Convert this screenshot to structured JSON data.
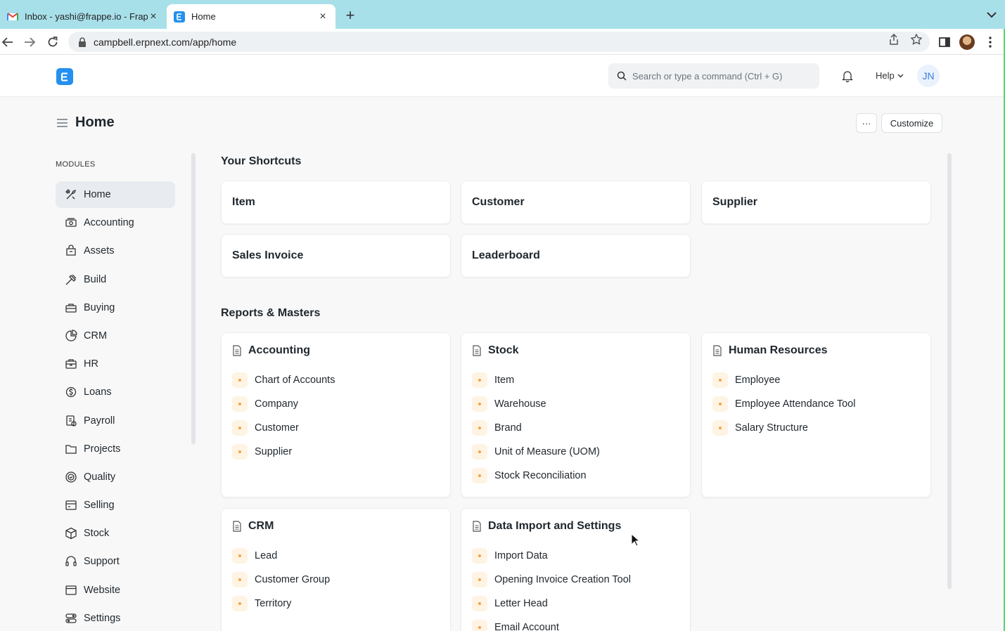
{
  "browser": {
    "tabs": [
      {
        "title": "Inbox - yashi@frappe.io - Frappe",
        "active": false
      },
      {
        "title": "Home",
        "active": true
      }
    ],
    "url": "campbell.erpnext.com/app/home"
  },
  "navbar": {
    "search_placeholder": "Search or type a command (Ctrl + G)",
    "help_label": "Help",
    "avatar_initials": "JN"
  },
  "page": {
    "title": "Home",
    "more_label": "···",
    "customize_label": "Customize"
  },
  "sidebar": {
    "heading": "MODULES",
    "items": [
      {
        "label": "Home",
        "icon": "tools-icon",
        "active": true
      },
      {
        "label": "Accounting",
        "icon": "accounting-icon"
      },
      {
        "label": "Assets",
        "icon": "assets-icon"
      },
      {
        "label": "Build",
        "icon": "build-icon"
      },
      {
        "label": "Buying",
        "icon": "buying-icon"
      },
      {
        "label": "CRM",
        "icon": "crm-icon"
      },
      {
        "label": "HR",
        "icon": "hr-icon"
      },
      {
        "label": "Loans",
        "icon": "loans-icon"
      },
      {
        "label": "Payroll",
        "icon": "payroll-icon"
      },
      {
        "label": "Projects",
        "icon": "projects-icon"
      },
      {
        "label": "Quality",
        "icon": "quality-icon"
      },
      {
        "label": "Selling",
        "icon": "selling-icon"
      },
      {
        "label": "Stock",
        "icon": "stock-icon"
      },
      {
        "label": "Support",
        "icon": "support-icon"
      },
      {
        "label": "Website",
        "icon": "website-icon"
      },
      {
        "label": "Settings",
        "icon": "settings-icon"
      }
    ]
  },
  "shortcuts": {
    "heading": "Your Shortcuts",
    "items": [
      "Item",
      "Customer",
      "Supplier",
      "Sales Invoice",
      "Leaderboard"
    ]
  },
  "reports": {
    "heading": "Reports & Masters",
    "cards": [
      {
        "title": "Accounting",
        "links": [
          "Chart of Accounts",
          "Company",
          "Customer",
          "Supplier"
        ]
      },
      {
        "title": "Stock",
        "links": [
          "Item",
          "Warehouse",
          "Brand",
          "Unit of Measure (UOM)",
          "Stock Reconciliation"
        ]
      },
      {
        "title": "Human Resources",
        "links": [
          "Employee",
          "Employee Attendance Tool",
          "Salary Structure"
        ]
      },
      {
        "title": "CRM",
        "links": [
          "Lead",
          "Customer Group",
          "Territory"
        ]
      },
      {
        "title": "Data Import and Settings",
        "links": [
          "Import Data",
          "Opening Invoice Creation Tool",
          "Letter Head",
          "Email Account"
        ]
      }
    ]
  },
  "colors": {
    "accent": "#2490ef",
    "link_dot": "#f4a340",
    "link_dot_bg": "#fff3e3"
  }
}
